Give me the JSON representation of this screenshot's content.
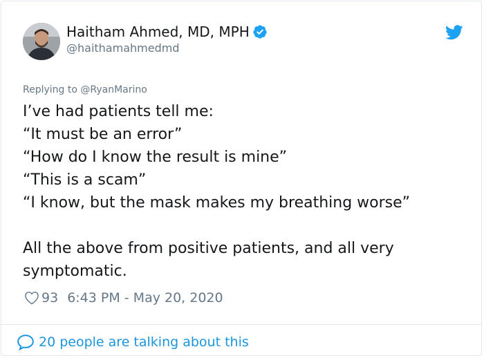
{
  "author": {
    "name": "Haitham Ahmed, MD, MPH",
    "handle": "@haithamahmedmd",
    "verified": true,
    "avatar_icon": "profile-photo"
  },
  "reply": {
    "prefix": "Replying to",
    "mention": "@RyanMarino"
  },
  "tweet": {
    "lines": [
      "I’ve had patients tell me:",
      "“It must be an error”",
      "“How do I know the result is mine”",
      "“This is a scam”",
      "“I know, but the mask makes my breathing worse”"
    ],
    "paragraph2": [
      "All the above from positive patients, and all very",
      "symptomatic."
    ]
  },
  "meta": {
    "like_count": "93",
    "timestamp": "6:43 PM - May 20, 2020"
  },
  "footer": {
    "talking": "20 people are talking about this"
  },
  "colors": {
    "brand": "#1da1f2",
    "link": "#1b95e0",
    "muted": "#657786",
    "text": "#14171a"
  }
}
